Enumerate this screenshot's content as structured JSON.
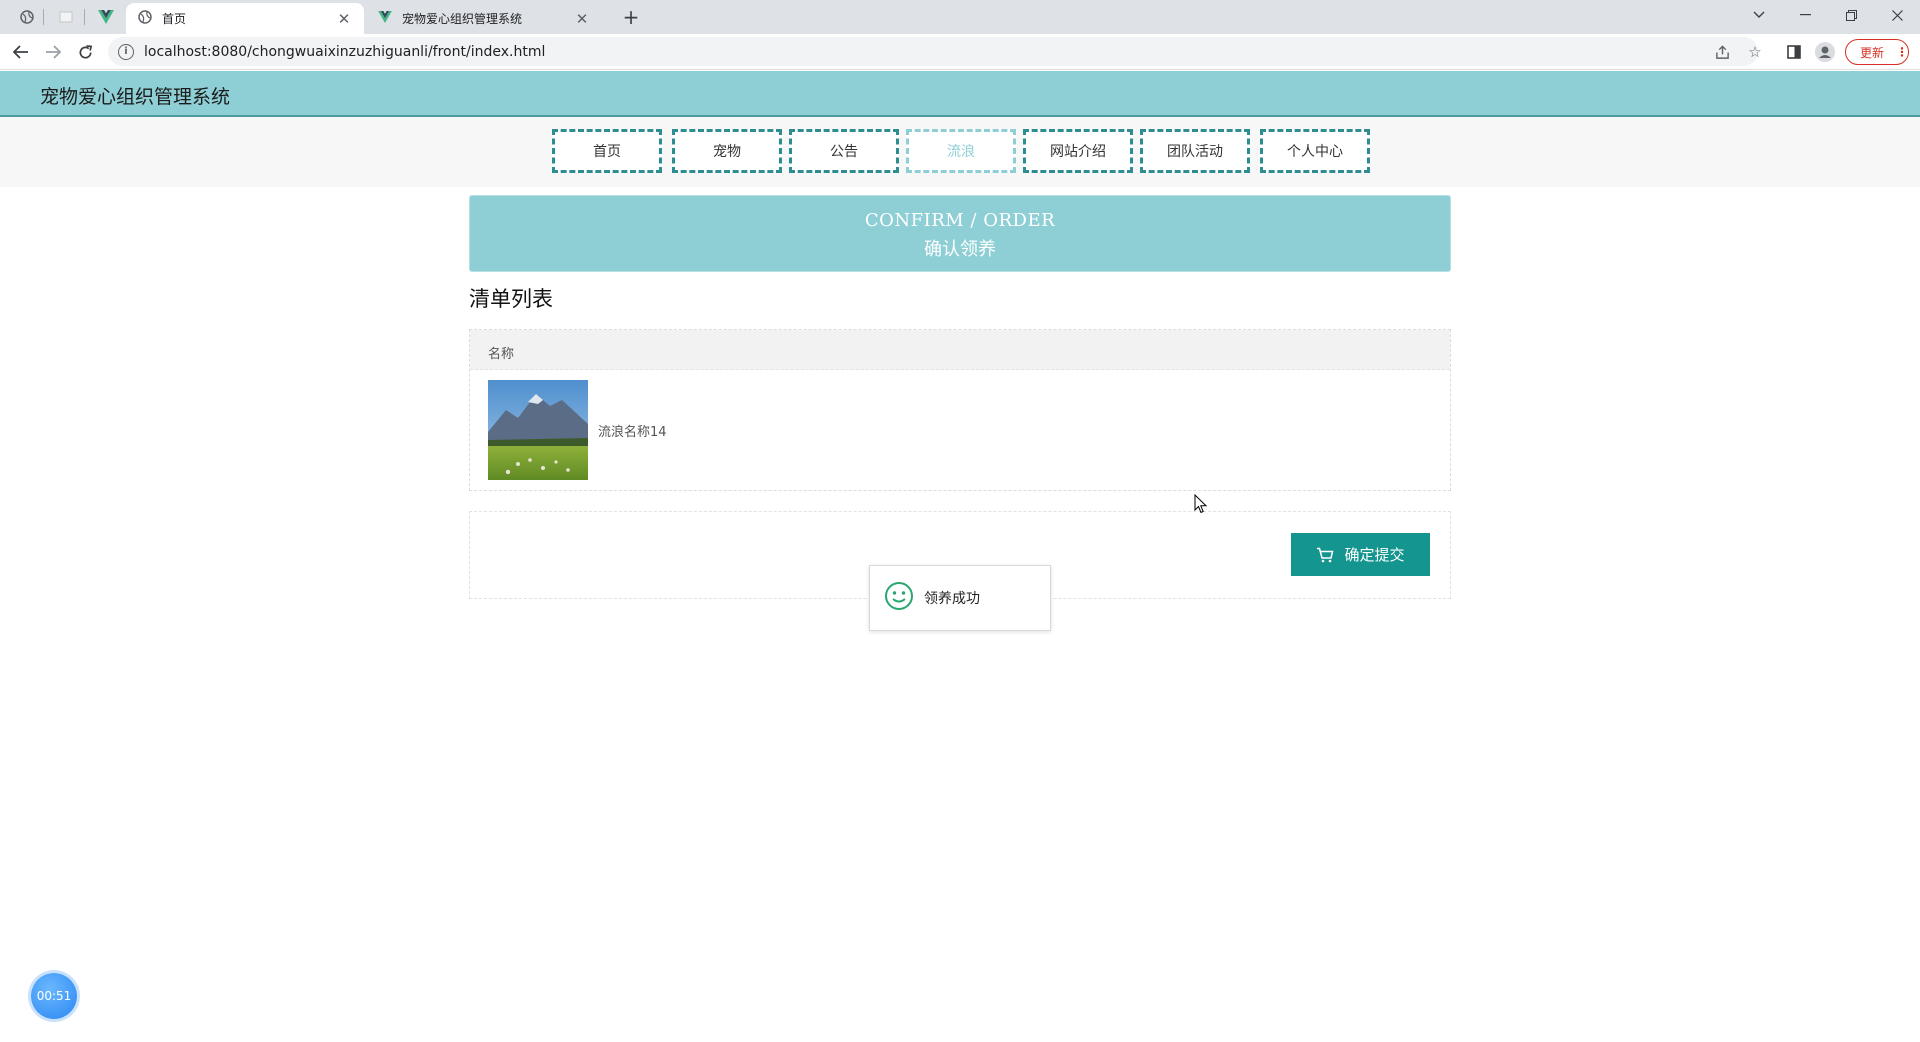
{
  "browser": {
    "tabs": [
      {
        "title": "首页",
        "active": true
      },
      {
        "title": "宠物爱心组织管理系统",
        "active": false
      }
    ],
    "url": "localhost:8080/chongwuaixinzuzhiguanli/front/index.html",
    "update_label": "更新"
  },
  "site": {
    "title": "宠物爱心组织管理系统",
    "nav": [
      {
        "label": "首页",
        "active": false
      },
      {
        "label": "宠物",
        "active": false
      },
      {
        "label": "公告",
        "active": false
      },
      {
        "label": "流浪",
        "active": true
      },
      {
        "label": "网站介绍",
        "active": false
      },
      {
        "label": "团队活动",
        "active": false
      },
      {
        "label": "个人中心",
        "active": false
      }
    ]
  },
  "banner": {
    "en": "CONFIRM / ORDER",
    "zh": "确认领养"
  },
  "list": {
    "title": "清单列表",
    "header": "名称",
    "items": [
      {
        "name": "流浪名称14",
        "image": "mountain-meadow-photo"
      }
    ]
  },
  "submit": {
    "label": "确定提交",
    "icon": "cart-icon"
  },
  "toast": {
    "message": "领养成功",
    "icon": "smile-icon"
  },
  "timer": {
    "text": "00:51"
  },
  "colors": {
    "accent": "#8ecfd6",
    "nav_border": "#2e8d91",
    "button": "#14958f",
    "toast_icon": "#2aa66f"
  }
}
